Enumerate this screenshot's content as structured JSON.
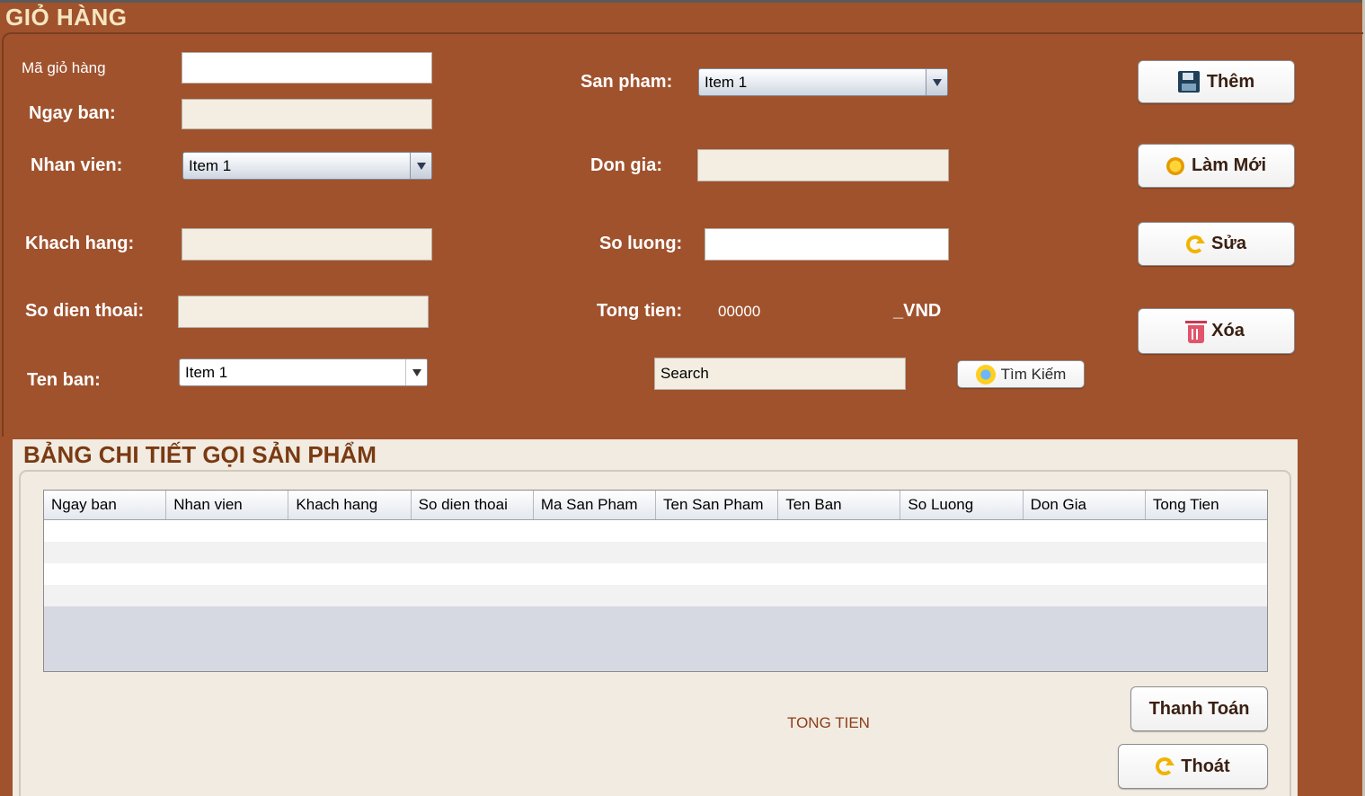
{
  "window": {
    "title": "GIỎ HÀNG"
  },
  "form": {
    "ma_gio_hang": {
      "label": "Mã giỏ hàng",
      "value": ""
    },
    "ngay_ban": {
      "label": "Ngay ban:",
      "value": ""
    },
    "nhan_vien": {
      "label": "Nhan vien:",
      "selected": "Item 1"
    },
    "khach_hang": {
      "label": "Khach hang:",
      "value": ""
    },
    "so_dien_thoai": {
      "label": "So dien thoai:",
      "value": ""
    },
    "ten_ban": {
      "label": "Ten ban:",
      "selected": "Item 1"
    },
    "san_pham": {
      "label": "San pham:",
      "selected": "Item 1"
    },
    "don_gia": {
      "label": "Don gia:",
      "value": ""
    },
    "so_luong": {
      "label": "So luong:",
      "value": ""
    },
    "tong_tien": {
      "label": "Tong tien:",
      "value": "00000",
      "unit": "_VND"
    },
    "search": {
      "value": "Search"
    }
  },
  "buttons": {
    "them": "Thêm",
    "lam_moi": "Làm Mới",
    "sua": "Sửa",
    "xoa": "Xóa",
    "tim_kiem": "Tìm Kiếm",
    "thanh_toan": "Thanh Toán",
    "thoat": "Thoát"
  },
  "detail": {
    "title": "BẢNG CHI TIẾT GỌI SẢN PHẨM",
    "columns": [
      "Ngay ban",
      "Nhan vien",
      "Khach hang",
      "So dien thoai",
      "Ma San Pham",
      "Ten San Pham",
      "Ten Ban",
      "So Luong",
      "Don Gia",
      "Tong Tien"
    ],
    "rows": [],
    "total_label": "TONG TIEN"
  },
  "icons": {
    "them": "save-icon",
    "lam_moi": "reset-icon",
    "sua": "refresh-icon",
    "xoa": "trash-icon",
    "tim_kiem": "search-icon",
    "thoat": "refresh-icon"
  },
  "colors": {
    "background": "#a0522d",
    "title": "#f5e6c0",
    "panel": "#f1ebe1",
    "panel_title": "#7a3a12"
  }
}
